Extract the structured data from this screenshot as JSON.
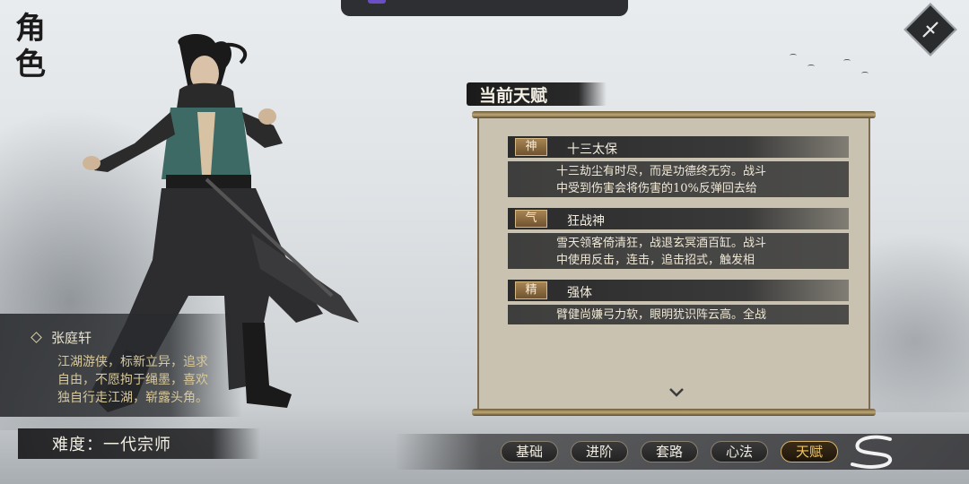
{
  "screen": {
    "title_chars": [
      "角",
      "色"
    ]
  },
  "character": {
    "name": "张庭轩",
    "description_lines": [
      "江湖游侠，标新立异，追求",
      "自由，不愿拘于绳墨，喜欢",
      "独自行走江湖，崭露头角。"
    ],
    "difficulty_label": "难度：一代宗师"
  },
  "talents": {
    "section_title": "当前天赋",
    "items": [
      {
        "tag": "神",
        "name": "十三太保",
        "desc_lines": [
          "十三劫尘有时尽，而是功德终无穷。战斗",
          "中受到伤害会将伤害的10%反弹回去给"
        ]
      },
      {
        "tag": "气",
        "name": "狂战神",
        "desc_lines": [
          "雪天领客倚清狂，战退玄冥酒百缸。战斗",
          "中使用反击，连击，追击招式，触发相"
        ]
      },
      {
        "tag": "精",
        "name": "强体",
        "desc_lines": [
          "臂健尚嫌弓力软，眼明犹识阵云高。全战"
        ]
      }
    ]
  },
  "tabs": [
    {
      "label": "基础",
      "active": false
    },
    {
      "label": "进阶",
      "active": false
    },
    {
      "label": "套路",
      "active": false
    },
    {
      "label": "心法",
      "active": false
    },
    {
      "label": "天赋",
      "active": true
    }
  ],
  "colors": {
    "active_tab": "#f0c55f",
    "tag_bg": "#8a6a40",
    "scroll_paper": "#c9c2b0"
  }
}
